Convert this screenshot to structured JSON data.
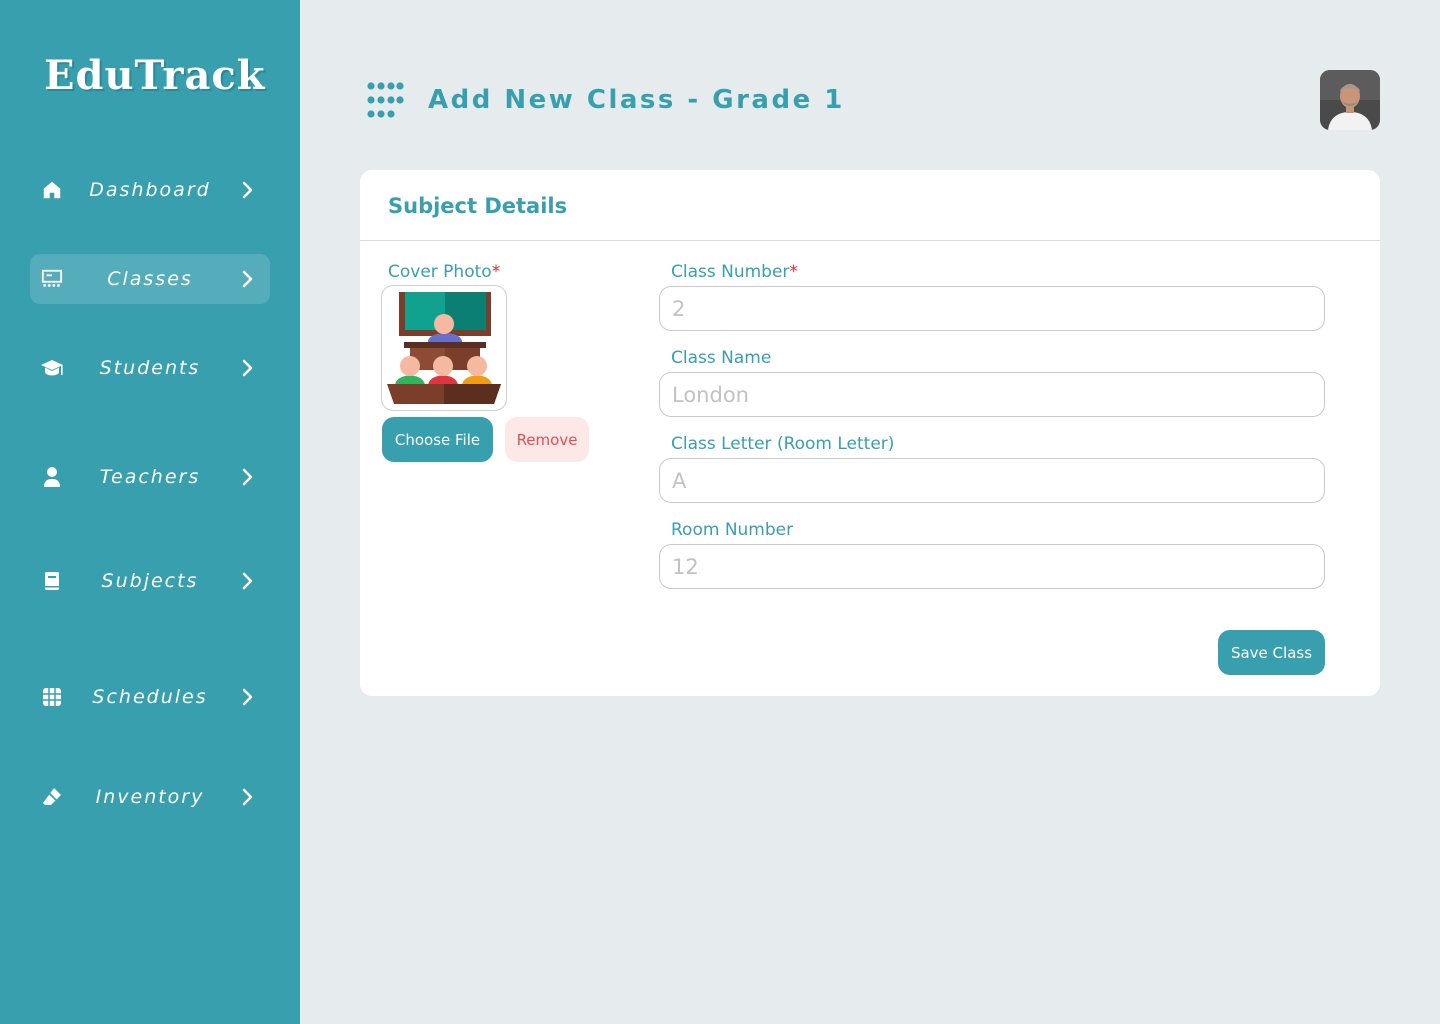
{
  "app": {
    "name": "EduTrack"
  },
  "sidebar": {
    "items": [
      {
        "label": "Dashboard",
        "icon": "home-icon",
        "active": false
      },
      {
        "label": "Classes",
        "icon": "classroom-icon",
        "active": true
      },
      {
        "label": "Students",
        "icon": "graduation-cap-icon",
        "active": false
      },
      {
        "label": "Teachers",
        "icon": "person-icon",
        "active": false
      },
      {
        "label": "Subjects",
        "icon": "book-icon",
        "active": false
      },
      {
        "label": "Schedules",
        "icon": "calendar-grid-icon",
        "active": false
      },
      {
        "label": "Inventory",
        "icon": "eraser-icon",
        "active": false
      }
    ]
  },
  "header": {
    "title": "Add New Class - Grade 1",
    "menu_icon": "grid-dots-icon",
    "avatar_icon": "user-avatar"
  },
  "form": {
    "section_title": "Subject Details",
    "cover_photo": {
      "label": "Cover Photo",
      "required_mark": "*",
      "choose_label": "Choose File",
      "remove_label": "Remove",
      "image_icon": "classroom-illustration"
    },
    "fields": {
      "class_number": {
        "label": "Class Number",
        "required_mark": "*",
        "placeholder": "2",
        "value": ""
      },
      "class_name": {
        "label": "Class Name",
        "placeholder": "London",
        "value": ""
      },
      "class_letter": {
        "label": "Class Letter (Room Letter)",
        "placeholder": "A",
        "value": ""
      },
      "room_number": {
        "label": "Room Number",
        "placeholder": "12",
        "value": ""
      }
    },
    "save_label": "Save Class"
  },
  "colors": {
    "primary": "#389faf",
    "background": "#e6ebee",
    "danger": "#e02b2b",
    "danger_bg": "#fde8e8"
  }
}
